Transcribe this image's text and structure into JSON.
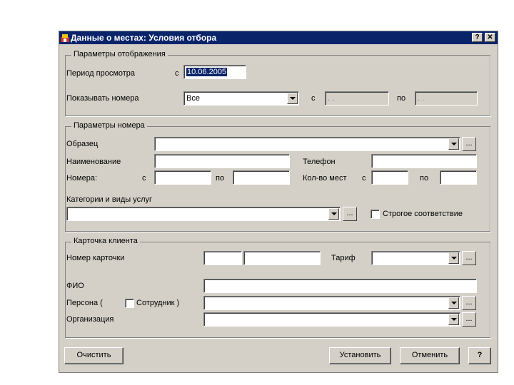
{
  "window": {
    "title": "Данные о местах: Условия отбора",
    "help_btn": "?",
    "close_btn": "✕"
  },
  "display_group": {
    "title": "Параметры отображения",
    "period_label": "Период просмотра",
    "from_label": "с",
    "period_value": "10.06.2005",
    "show_numbers_label": "Показывать номера",
    "show_numbers_value": "Все",
    "from2_label": "с",
    "to2_label": "по",
    "date_from_value": ". .",
    "date_to_value": ". ."
  },
  "room_group": {
    "title": "Параметры номера",
    "sample_label": "Образец",
    "name_label": "Наименование",
    "phone_label": "Телефон",
    "numbers_label": "Номера:",
    "numbers_from": "с",
    "numbers_to": "по",
    "seats_label": "Кол-во мест",
    "seats_from": "с",
    "seats_to": "по",
    "services_label": "Категории и виды услуг",
    "strict_label": "Строгое соответствие"
  },
  "client_group": {
    "title": "Карточка клиента",
    "card_label": "Номер карточки",
    "tariff_label": "Тариф",
    "fio_label": "ФИО",
    "person_label": "Персона (",
    "employee_label": "Сотрудник )",
    "org_label": "Организация"
  },
  "buttons": {
    "clear": "Очистить",
    "apply": "Установить",
    "cancel": "Отменить",
    "help": "?",
    "ellipsis": "..."
  }
}
